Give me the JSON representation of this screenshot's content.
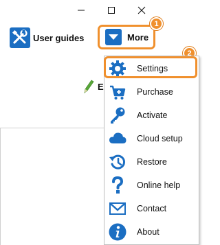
{
  "window_controls": {
    "minimize_icon": "minimize-icon",
    "maximize_icon": "maximize-icon",
    "close_icon": "close-icon"
  },
  "toolbar": {
    "user_guides_label": "User guides",
    "more_label": "More",
    "edit_label": "Ed"
  },
  "badges": [
    "1",
    "2"
  ],
  "menu": {
    "items": [
      {
        "label": "Settings",
        "icon": "gear-icon"
      },
      {
        "label": "Purchase",
        "icon": "cart-icon"
      },
      {
        "label": "Activate",
        "icon": "key-icon"
      },
      {
        "label": "Cloud setup",
        "icon": "cloud-icon"
      },
      {
        "label": "Restore",
        "icon": "restore-icon"
      },
      {
        "label": "Online help",
        "icon": "question-icon"
      },
      {
        "label": "Contact",
        "icon": "envelope-icon"
      },
      {
        "label": "About",
        "icon": "info-icon"
      }
    ]
  },
  "colors": {
    "highlight": "#f0902d",
    "icon_blue": "#1b6ec2",
    "pencil_green": "#5aa83a"
  }
}
